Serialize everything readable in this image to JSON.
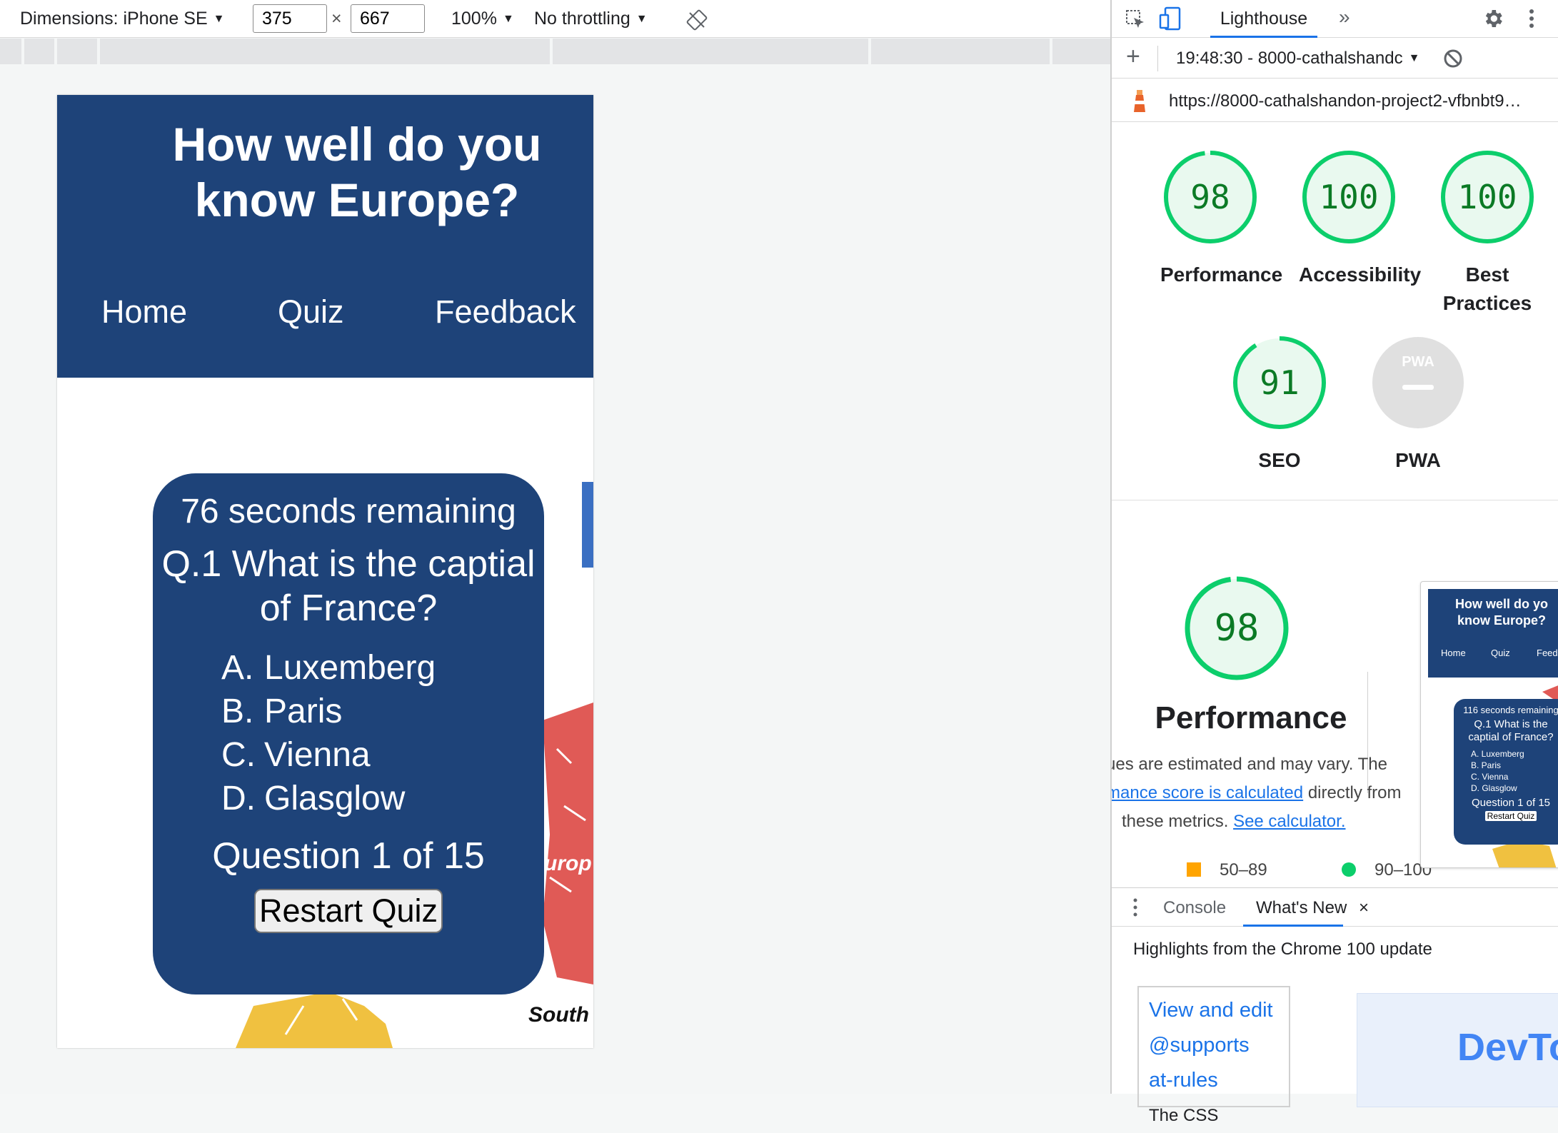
{
  "device_toolbar": {
    "dimensions_label": "Dimensions: iPhone SE",
    "width": "375",
    "height": "667",
    "times": "×",
    "zoom": "100%",
    "throttling": "No throttling"
  },
  "site": {
    "title": "How well do you know Europe?",
    "nav": [
      "Home",
      "Quiz",
      "Feedback"
    ],
    "quiz": {
      "timer": "76 seconds remaining",
      "question": "Q.1 What is the captial\nof France?",
      "answers": [
        {
          "letter": "A.",
          "text": "Luxemberg"
        },
        {
          "letter": "B.",
          "text": "Paris"
        },
        {
          "letter": "C.",
          "text": "Vienna"
        },
        {
          "letter": "D.",
          "text": "Glasglow"
        }
      ],
      "progress": "Question 1 of 15",
      "restart": "Restart Quiz"
    },
    "map_caption_visible": "South",
    "map_label_visible": "urop"
  },
  "devtools": {
    "tab": "Lighthouse",
    "report_selector": "19:48:30 - 8000-cathalshandc",
    "url": "https://8000-cathalshandon-project2-vfbnbt9…",
    "scores": [
      {
        "label": "Performance",
        "value": "98"
      },
      {
        "label": "Accessibility",
        "value": "100"
      },
      {
        "label": "Best\nPractices",
        "value": "100"
      },
      {
        "label": "SEO",
        "value": "91"
      },
      {
        "label": "PWA",
        "value": "PWA"
      }
    ],
    "performance": {
      "score": "98",
      "title": "Performance",
      "desc_part1": "ues are estimated and may vary. The",
      "desc_link1": "mance score is calculated",
      "desc_part2": "directly from",
      "desc_part3": "these metrics.",
      "desc_link2": "See calculator.",
      "legend": [
        "50–89",
        "90–100"
      ],
      "legend_colors": [
        "#ffa400",
        "#0cce6b"
      ]
    },
    "thumbnail": {
      "title": "How well do yo\nknow Europe?",
      "nav": [
        "Home",
        "Quiz",
        "Feedb"
      ],
      "timer": "116 seconds remaining",
      "question": "Q.1 What is the\ncaptial of France?",
      "answers": [
        "A. Luxemberg",
        "B. Paris",
        "C. Vienna",
        "D. Glasglow"
      ],
      "progress": "Question 1 of 15",
      "restart": "Restart Quiz"
    },
    "drawer": {
      "tabs": [
        "Console",
        "What's New"
      ],
      "close": "×",
      "highlights": "Highlights from the Chrome 100 update",
      "card_left": "View and edit @supports at-rules",
      "card_left_fade": "The CSS",
      "card_right": "DevTo"
    }
  },
  "colors": {
    "site_blue": "#1e4379",
    "gauge_green": "#0cce6b",
    "gauge_text": "#0b7a25",
    "map_red": "#e05a56",
    "map_yellow": "#f0c140",
    "link_blue": "#1a73e8"
  }
}
